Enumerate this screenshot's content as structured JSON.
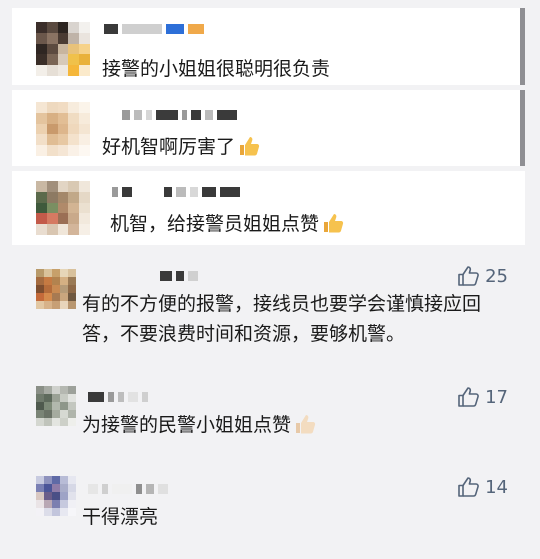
{
  "comments": [
    {
      "text": "接警的小姐姐很聪明很负责",
      "emoji": "thumbs-up-icon",
      "likes": ""
    },
    {
      "text": "好机智啊厉害了",
      "emoji": "thumbs-up-icon",
      "likes": ""
    },
    {
      "text": "机智，给接警员姐姐点赞",
      "emoji": "thumbs-up-icon",
      "likes": ""
    },
    {
      "text": "有的不方便的报警，接线员也要学会谨慎接应回答，不要浪费时间和资源，要够机警。",
      "likes": "25"
    },
    {
      "text": "为接警的民警小姐姐点赞",
      "emoji": "thumbs-up-icon",
      "likes": "17"
    },
    {
      "text": "干得漂亮",
      "likes": "14"
    }
  ],
  "colors": {
    "background": "#f2f2f4",
    "card": "#ffffff",
    "like": "#55657a",
    "scrollbar": "#8f8f93"
  }
}
